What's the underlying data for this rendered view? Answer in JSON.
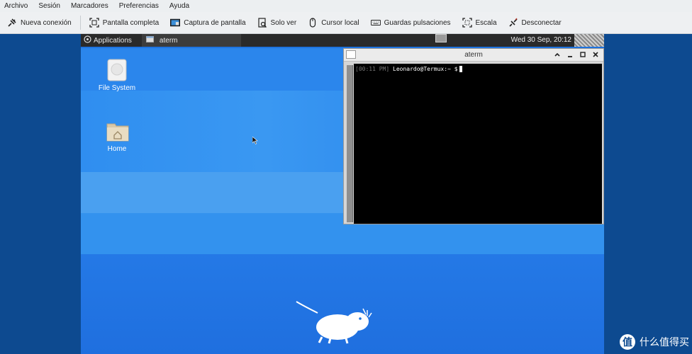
{
  "menubar": {
    "items": [
      "Archivo",
      "Sesión",
      "Marcadores",
      "Preferencias",
      "Ayuda"
    ]
  },
  "toolbar": {
    "new_connection": "Nueva conexión",
    "fullscreen": "Pantalla completa",
    "screenshot": "Captura de pantalla",
    "view_only": "Solo ver",
    "local_cursor": "Cursor local",
    "grab_keys": "Guardas pulsaciones",
    "scale": "Escala",
    "disconnect": "Desconectar"
  },
  "remote": {
    "panel": {
      "applications": "Applications",
      "task": "aterm",
      "clock": "Wed 30 Sep, 20:12"
    },
    "desktop_icons": [
      {
        "label": "File System",
        "icon": "drive-icon"
      },
      {
        "label": "Home",
        "icon": "home-folder-icon"
      }
    ],
    "terminal": {
      "title": "aterm",
      "timestamp": "[00:11 PM]",
      "prompt": "Leonardo@Termux:~ $"
    }
  },
  "watermark": {
    "logo": "值",
    "text": "什么值得买"
  },
  "colors": {
    "desktop_blue": "#1e73e0",
    "outer_blue": "#0d4a90",
    "panel_dark": "#2a2a2a"
  }
}
